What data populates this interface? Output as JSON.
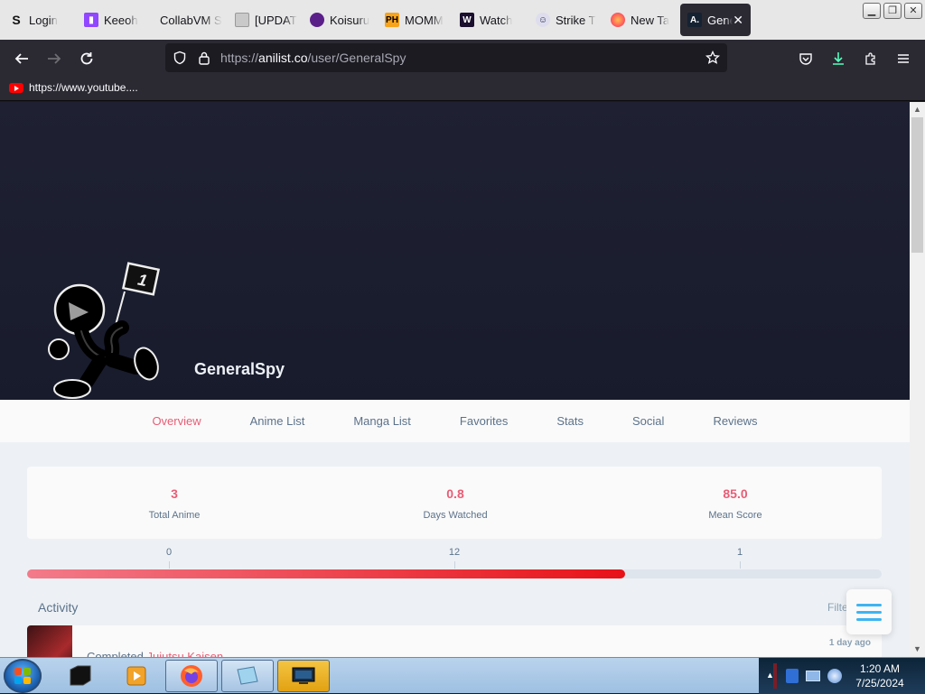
{
  "browser": {
    "tabs": [
      {
        "title": "Login",
        "favicon": "S"
      },
      {
        "title": "Keeoh",
        "favicon": "twitch-icon"
      },
      {
        "title": "CollabVM S",
        "favicon": "none"
      },
      {
        "title": "[UPDAT",
        "favicon": "page-icon"
      },
      {
        "title": "Koisuru",
        "favicon": "purple-icon"
      },
      {
        "title": "MOMM",
        "favicon": "PH"
      },
      {
        "title": "Watch",
        "favicon": "W"
      },
      {
        "title": "Strike T",
        "favicon": "person-icon"
      },
      {
        "title": "New Ta",
        "favicon": "firefox-icon"
      },
      {
        "title": "Gene",
        "favicon": "A."
      }
    ],
    "url_prefix": "https://",
    "url_domain": "anilist.co",
    "url_path": "/user/GeneralSpy",
    "bookmark": "https://www.youtube...."
  },
  "profile": {
    "username": "GeneralSpy",
    "nav": [
      "Overview",
      "Anime List",
      "Manga List",
      "Favorites",
      "Stats",
      "Social",
      "Reviews"
    ],
    "stats": [
      {
        "value": "3",
        "label": "Total Anime"
      },
      {
        "value": "0.8",
        "label": "Days Watched"
      },
      {
        "value": "85.0",
        "label": "Mean Score"
      }
    ],
    "progress": {
      "ticks": [
        "0",
        "12",
        "1"
      ],
      "fill_fraction": 0.7
    },
    "activity_heading": "Activity",
    "filter_label": "Filter",
    "activity": {
      "status": "Completed",
      "title": "Jujutsu Kaisen",
      "time": "1 day ago"
    }
  },
  "taskbar": {
    "time": "1:20 AM",
    "date": "7/25/2024"
  },
  "colors": {
    "accent": "#e85d75",
    "bar_end": "#e71217",
    "menu_blue": "#3db4f2"
  }
}
